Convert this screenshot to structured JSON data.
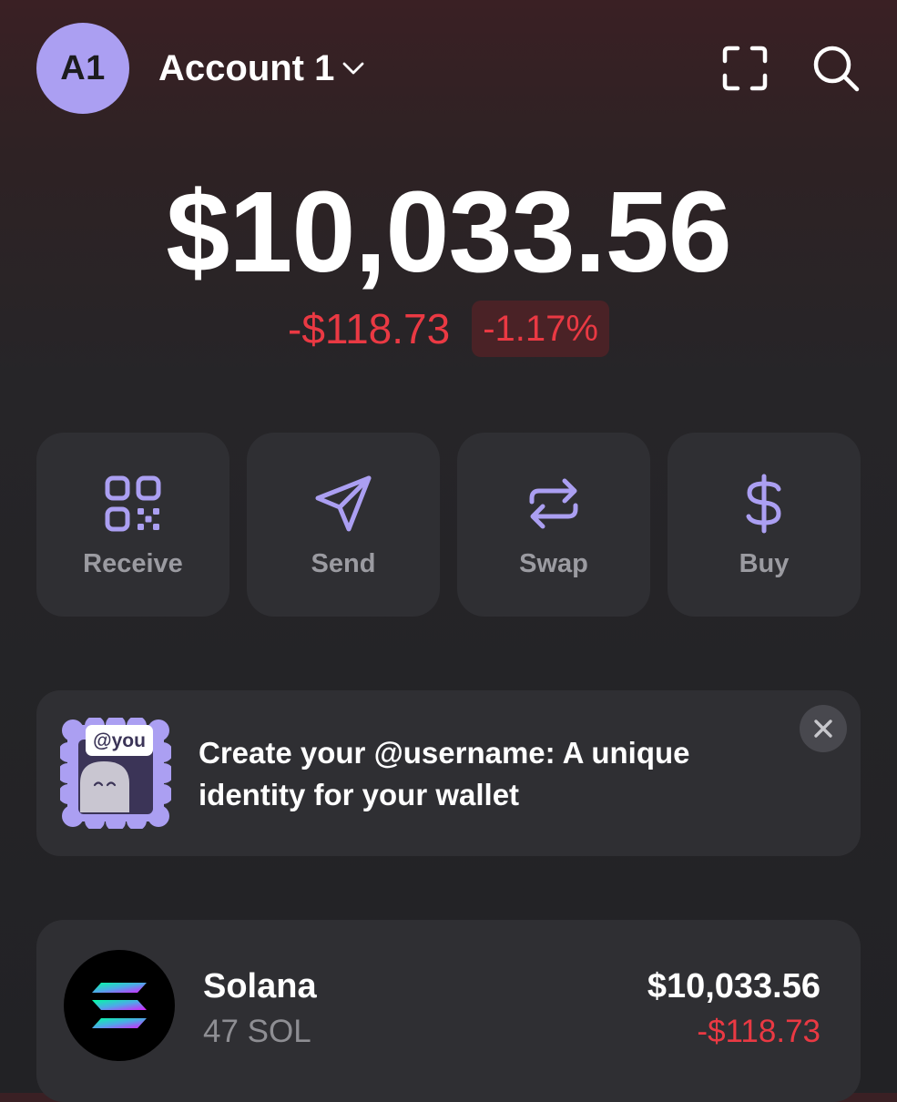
{
  "header": {
    "avatar_initials": "A1",
    "account_name": "Account 1",
    "icons": [
      "chevron-down-icon",
      "scan-icon",
      "search-icon"
    ]
  },
  "portfolio": {
    "balance": "$10,033.56",
    "change_amount": "-$118.73",
    "change_percent": "-1.17%"
  },
  "actions": [
    {
      "label": "Receive",
      "icon": "qr-code-icon"
    },
    {
      "label": "Send",
      "icon": "send-icon"
    },
    {
      "label": "Swap",
      "icon": "swap-icon"
    },
    {
      "label": "Buy",
      "icon": "dollar-icon"
    }
  ],
  "banner": {
    "badge": "@you",
    "text": "Create your @username: A unique identity for your wallet"
  },
  "tokens": [
    {
      "name": "Solana",
      "amount": "47 SOL",
      "value": "$10,033.56",
      "change": "-$118.73"
    }
  ],
  "colors": {
    "accent": "#ab9ff2",
    "negative": "#ea3943",
    "card": "#2f2f33",
    "muted_text": "#9b9ba1"
  }
}
